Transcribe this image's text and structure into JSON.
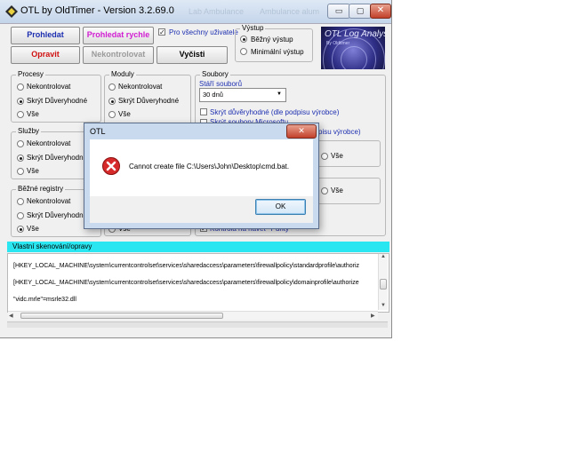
{
  "window": {
    "title": "OTL by OldTimer - Version 3.2.69.0",
    "titlebar_ghost_left": "Lab Ambulance",
    "titlebar_ghost_right": "Ambulance alum",
    "minimize_symbol": "▭",
    "maximize_symbol": "▢",
    "close_symbol": "✕"
  },
  "toolbar": {
    "scan_label": "Prohledat",
    "quick_scan_label": "Prohledat rychle",
    "fix_label": "Opravit",
    "none_label": "Nekontrolovat",
    "clean_label": "Vyčisti",
    "all_users_label": "Pro všechny uživatele",
    "all_users_checked": "✓"
  },
  "output_group": {
    "title": "Výstup",
    "standard": "Běžný výstup",
    "minimal": "Minimální výstup"
  },
  "logo": {
    "title": "OTL Log Analysis",
    "subtitle": "By Oldtimer"
  },
  "processes": {
    "title": "Procesy",
    "opt_none": "Nekontrolovat",
    "opt_hide": "Skrýt Důveryhodné",
    "opt_all": "Vše"
  },
  "modules": {
    "title": "Moduly",
    "opt_none": "Nekontrolovat",
    "opt_hide": "Skrýt Důveryhodné",
    "opt_all": "Vše"
  },
  "files": {
    "title": "Soubory",
    "age_label": "Stáří souborů",
    "age_value": "30 dnů",
    "hide_trusted": "Skrýt důvěryhodné (dle podpisu výrobce)",
    "hide_microsoft": "Skrýt soubory Microsoftu",
    "sig_suffix": "pisu výrobce)",
    "all1": "Vše",
    "all2": "Vše",
    "purity": "Kontrola na havěť \"Purity\""
  },
  "services": {
    "title": "Služby",
    "opt_none": "Nekontrolovat",
    "opt_hide": "Skrýt Důveryhodné",
    "opt_all": "Vše"
  },
  "registry": {
    "title": "Běžné registry",
    "opt_none": "Nekontrolovat",
    "opt_hide": "Skrýt Důveryhodné",
    "opt_all": "Vše",
    "mid_all": "Vše"
  },
  "custom": {
    "header": "Vlastní skenování/opravy",
    "lines": [
      "[HKEY_LOCAL_MACHINE\\system\\currentcontrolset\\services\\sharedaccess\\parameters\\firewallpolicy\\standardprofile\\authoriz",
      "[HKEY_LOCAL_MACHINE\\system\\currentcontrolset\\services\\sharedaccess\\parameters\\firewallpolicy\\domainprofile\\authorize",
      "\"vidc.mrle\"=msrle32.dll"
    ]
  },
  "dialog": {
    "title": "OTL",
    "message": "Cannot create file C:\\Users\\John\\Desktop\\cmd.bat.",
    "ok_label": "OK",
    "close_symbol": "✕"
  },
  "colors": {
    "scan_text": "#1d2fb0",
    "quick_scan_text": "#d21ed2",
    "fix_text": "#d01010",
    "none_text": "#9a9a9a",
    "cyan_header": "#29e6f0"
  }
}
